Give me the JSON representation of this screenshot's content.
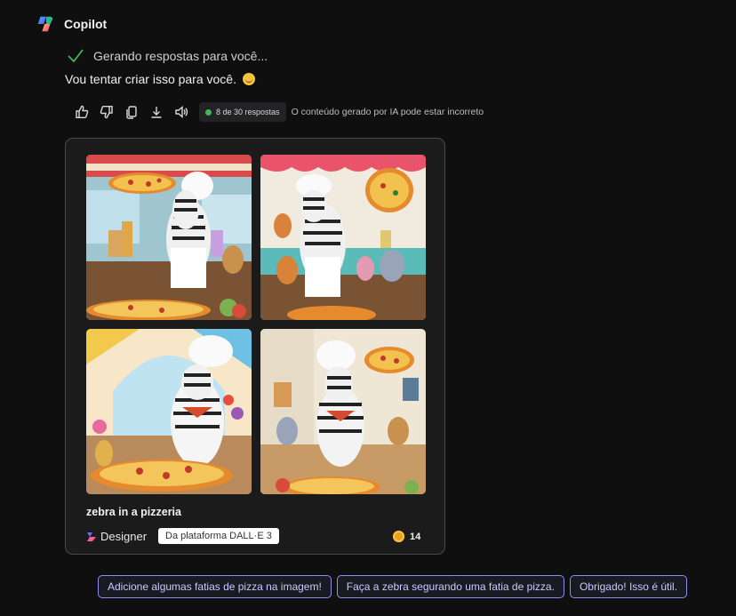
{
  "app": {
    "name": "Copilot"
  },
  "status": {
    "text": "Gerando respostas para você..."
  },
  "reply": {
    "text": "Vou tentar criar isso para você."
  },
  "actions": {
    "icons": [
      "thumbs-up-icon",
      "thumbs-down-icon",
      "copy-icon",
      "download-icon",
      "speaker-icon"
    ],
    "response_count": "8 de 30 respostas",
    "disclaimer": "O conteúdo gerado por IA pode estar incorreto"
  },
  "image_card": {
    "caption": "zebra in a pizzeria",
    "designer_label": "Designer",
    "platform_badge": "Da plataforma DALL·E 3",
    "coins": "14"
  },
  "suggestions": [
    "Adicione algumas fatias de pizza na imagem!",
    "Faça a zebra segurando uma fatia de pizza.",
    "Obrigado! Isso é útil."
  ],
  "colors": {
    "background": "#0f0f10",
    "card": "#1b1b1c",
    "chip_border": "#8d8ff0",
    "chip_text": "#c9caff",
    "status_check": "#3fb950"
  }
}
